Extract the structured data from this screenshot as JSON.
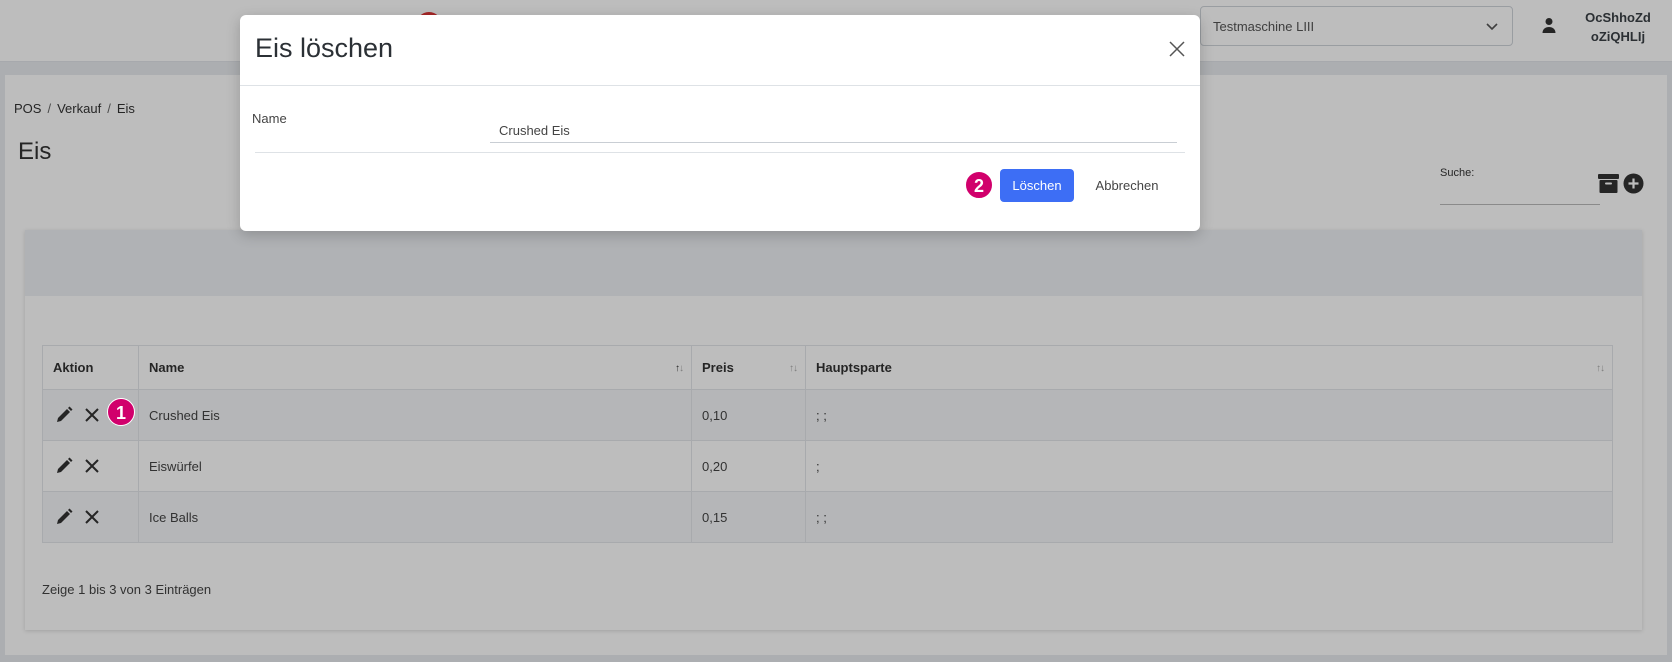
{
  "topbar": {
    "machine_select": "Testmaschine LIII",
    "user_line1": "OcShhoZd",
    "user_line2": "oZiQHLIj"
  },
  "breadcrumb": [
    "POS",
    "Verkauf",
    "Eis"
  ],
  "page_title": "Eis",
  "search": {
    "label": "Suche:",
    "value": ""
  },
  "table": {
    "headers": [
      "Aktion",
      "Name",
      "Preis",
      "Hauptsparte"
    ],
    "rows": [
      {
        "name": "Crushed Eis",
        "preis": "0,10",
        "hauptsparte": "; ;"
      },
      {
        "name": "Eiswürfel",
        "preis": "0,20",
        "hauptsparte": ";"
      },
      {
        "name": "Ice Balls",
        "preis": "0,15",
        "hauptsparte": "; ;"
      }
    ],
    "info": "Zeige 1 bis 3 von 3 Einträgen"
  },
  "modal": {
    "title": "Eis löschen",
    "name_label": "Name",
    "name_value": "Crushed Eis",
    "delete_label": "Löschen",
    "cancel_label": "Abbrechen"
  },
  "markers": {
    "step1": "1",
    "step2": "2"
  },
  "colors": {
    "primary": "#3d6ef5",
    "marker": "#d1006c"
  }
}
